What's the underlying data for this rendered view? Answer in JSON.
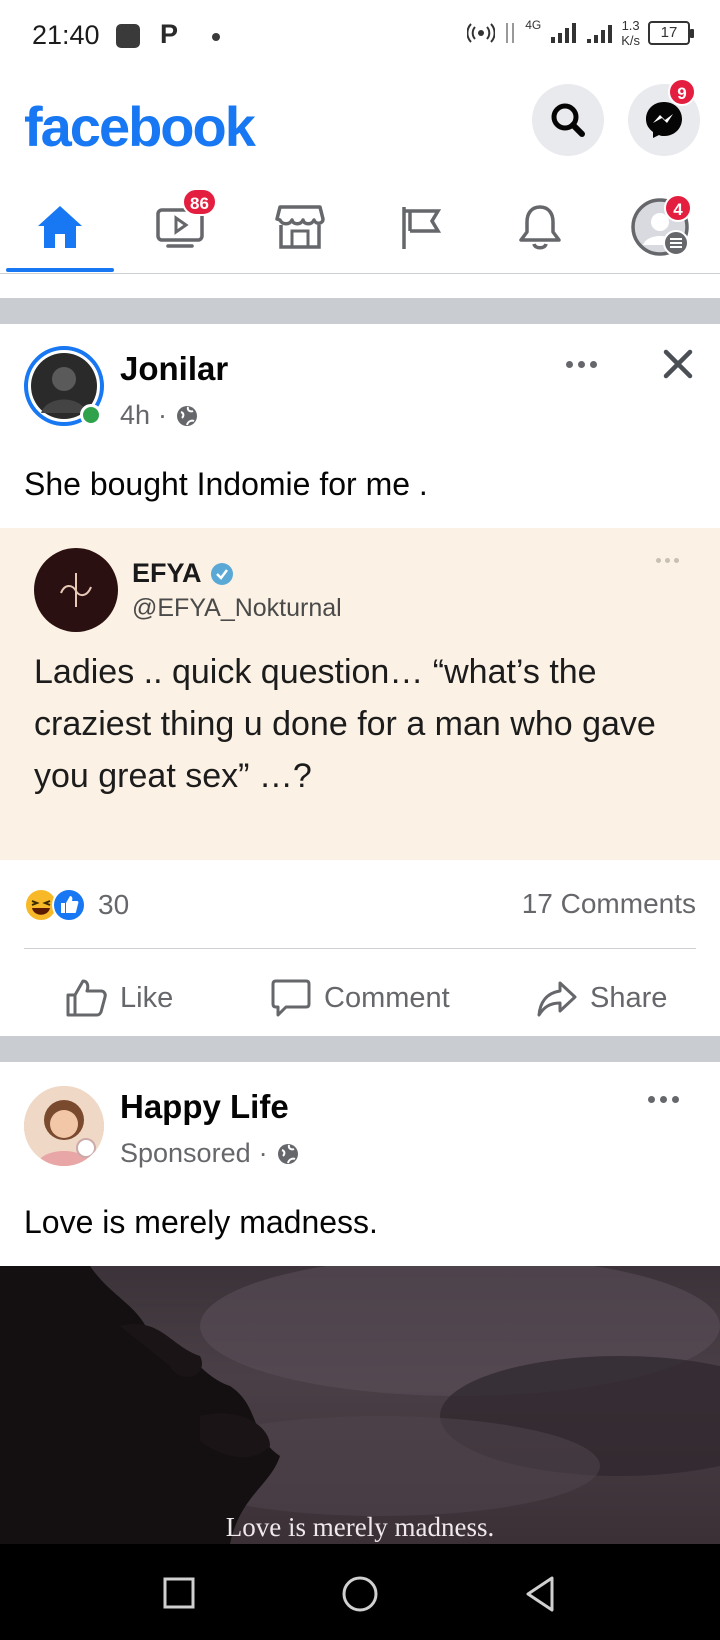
{
  "status_bar": {
    "time": "21:40",
    "carrier_icon": "P",
    "network": "4G",
    "speed_value": "1.3",
    "speed_unit": "K/s",
    "battery": "17"
  },
  "header": {
    "logo": "facebook",
    "messenger_badge": "9"
  },
  "tabs": [
    {
      "name": "home",
      "badge": ""
    },
    {
      "name": "watch",
      "badge": "86"
    },
    {
      "name": "marketplace",
      "badge": ""
    },
    {
      "name": "pages",
      "badge": ""
    },
    {
      "name": "notifications",
      "badge": ""
    },
    {
      "name": "menu",
      "badge": "4"
    }
  ],
  "post1": {
    "author": "Jonilar",
    "time": "4h",
    "separator": "·",
    "text": "She bought Indomie for me .",
    "quote": {
      "name": "EFYA",
      "handle": "@EFYA_Nokturnal",
      "text": "Ladies .. quick question… “what’s the craziest thing u done for a man who gave you great sex” …?"
    },
    "reactions_count": "30",
    "comments": "17 Comments",
    "actions": {
      "like": "Like",
      "comment": "Comment",
      "share": "Share"
    }
  },
  "post2": {
    "author": "Happy Life",
    "sponsored": "Sponsored",
    "separator": "·",
    "text": "Love is merely madness.",
    "image_caption": "Love is merely madness."
  },
  "colors": {
    "brand": "#1877f2",
    "badge": "#e41e3f",
    "quote_bg": "#fbf1e4"
  }
}
